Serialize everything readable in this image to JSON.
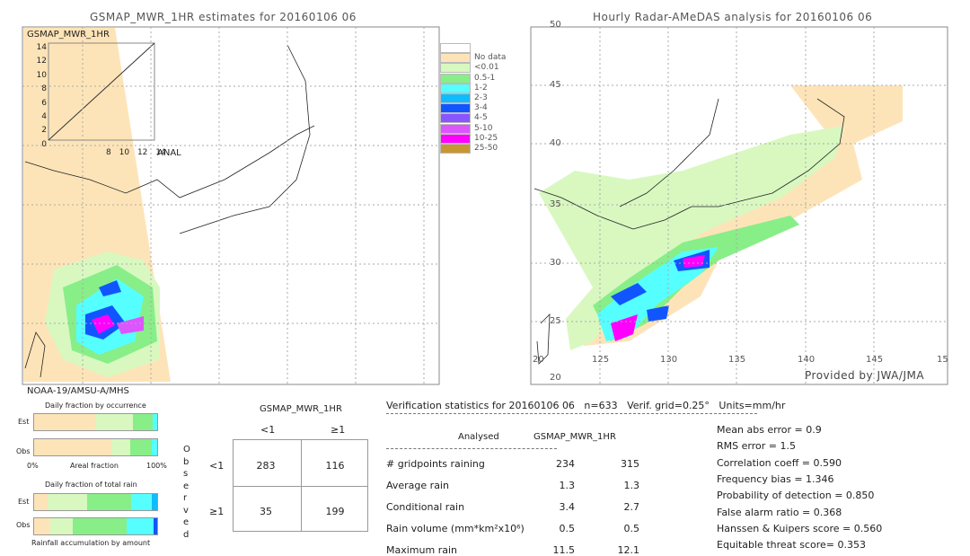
{
  "left_map": {
    "title": "GSMAP_MWR_1HR estimates for 20160106 06",
    "inset_label": "GSMAP_MWR_1HR",
    "inset_xlabel": "ANAL",
    "inset_ticks": [
      "0",
      "2",
      "4",
      "6",
      "8",
      "10",
      "12",
      "14"
    ],
    "sensor": "NOAA-19/AMSU-A/MHS"
  },
  "right_map": {
    "title": "Hourly Radar-AMeDAS analysis for 20160106 06",
    "lat_ticks": [
      "45",
      "40",
      "35",
      "30",
      "25",
      "20"
    ],
    "lon_ticks": [
      "125",
      "130",
      "135",
      "140",
      "145",
      "15"
    ],
    "top_tick": "50",
    "bottom_tick": "20",
    "credit": "Provided by JWA/JMA"
  },
  "legend": {
    "items": [
      {
        "label": "",
        "color": "#ffffff"
      },
      {
        "label": "No data",
        "color": "#fde4b8"
      },
      {
        "label": "<0.01",
        "color": "#d8f8c0"
      },
      {
        "label": "0.5-1",
        "color": "#88ee88"
      },
      {
        "label": "1-2",
        "color": "#55ffff"
      },
      {
        "label": "2-3",
        "color": "#11bbff"
      },
      {
        "label": "3-4",
        "color": "#1155ff"
      },
      {
        "label": "4-5",
        "color": "#8855ff"
      },
      {
        "label": "5-10",
        "color": "#dd55ff"
      },
      {
        "label": "10-25",
        "color": "#ff00ff"
      },
      {
        "label": "25-50",
        "color": "#c89632"
      }
    ]
  },
  "fractions": {
    "occurrence_title": "Daily fraction by occurrence",
    "est": "Est",
    "obs": "Obs",
    "axis_left": "0%",
    "axis_mid": "Areal fraction",
    "axis_right": "100%",
    "rain_title": "Daily fraction of total rain",
    "rain_footer": "Rainfall accumulation by amount",
    "occ_est": [
      {
        "f": 0.56,
        "c": "#fde4b8"
      },
      {
        "f": 0.33,
        "c": "#d8f8c0"
      },
      {
        "f": 0.18,
        "c": "#88ee88"
      },
      {
        "f": 0.04,
        "c": "#55ffff"
      }
    ],
    "occ_obs": [
      {
        "f": 0.69,
        "c": "#fde4b8"
      },
      {
        "f": 0.17,
        "c": "#d8f8c0"
      },
      {
        "f": 0.19,
        "c": "#88ee88"
      },
      {
        "f": 0.05,
        "c": "#55ffff"
      }
    ],
    "rain_est": [
      {
        "f": 0.12,
        "c": "#fde4b8"
      },
      {
        "f": 0.35,
        "c": "#d8f8c0"
      },
      {
        "f": 0.4,
        "c": "#88ee88"
      },
      {
        "f": 0.18,
        "c": "#55ffff"
      },
      {
        "f": 0.05,
        "c": "#11bbff"
      }
    ],
    "rain_obs": [
      {
        "f": 0.14,
        "c": "#fde4b8"
      },
      {
        "f": 0.19,
        "c": "#d8f8c0"
      },
      {
        "f": 0.45,
        "c": "#88ee88"
      },
      {
        "f": 0.23,
        "c": "#55ffff"
      },
      {
        "f": 0.03,
        "c": "#1155ff"
      }
    ]
  },
  "contingency": {
    "title": "GSMAP_MWR_1HR",
    "col_lt": "<1",
    "col_ge": "≥1",
    "row_lt": "<1",
    "row_ge": "≥1",
    "observed": "Observed",
    "values": [
      [
        "283",
        "116"
      ],
      [
        "35",
        "199"
      ]
    ]
  },
  "stats": {
    "header": "Verification statistics for 20160106 06   n=633   Verif. grid=0.25°   Units=mm/hr",
    "col_analysed": "Analysed",
    "col_gsmap": "GSMAP_MWR_1HR",
    "rows": [
      {
        "label": "# gridpoints raining",
        "a": "234",
        "g": "315"
      },
      {
        "label": "Average rain",
        "a": "1.3",
        "g": "1.3"
      },
      {
        "label": "Conditional rain",
        "a": "3.4",
        "g": "2.7"
      },
      {
        "label": "Rain volume (mm*km²x10⁶)",
        "a": "0.5",
        "g": "0.5"
      },
      {
        "label": "Maximum rain",
        "a": "11.5",
        "g": "12.1"
      }
    ],
    "scores": [
      "Mean abs error = 0.9",
      "RMS error = 1.5",
      "Correlation coeff = 0.590",
      "Frequency bias = 1.346",
      "Probability of detection = 0.850",
      "False alarm ratio = 0.368",
      "Hanssen & Kuipers score = 0.560",
      "Equitable threat score= 0.353"
    ]
  }
}
